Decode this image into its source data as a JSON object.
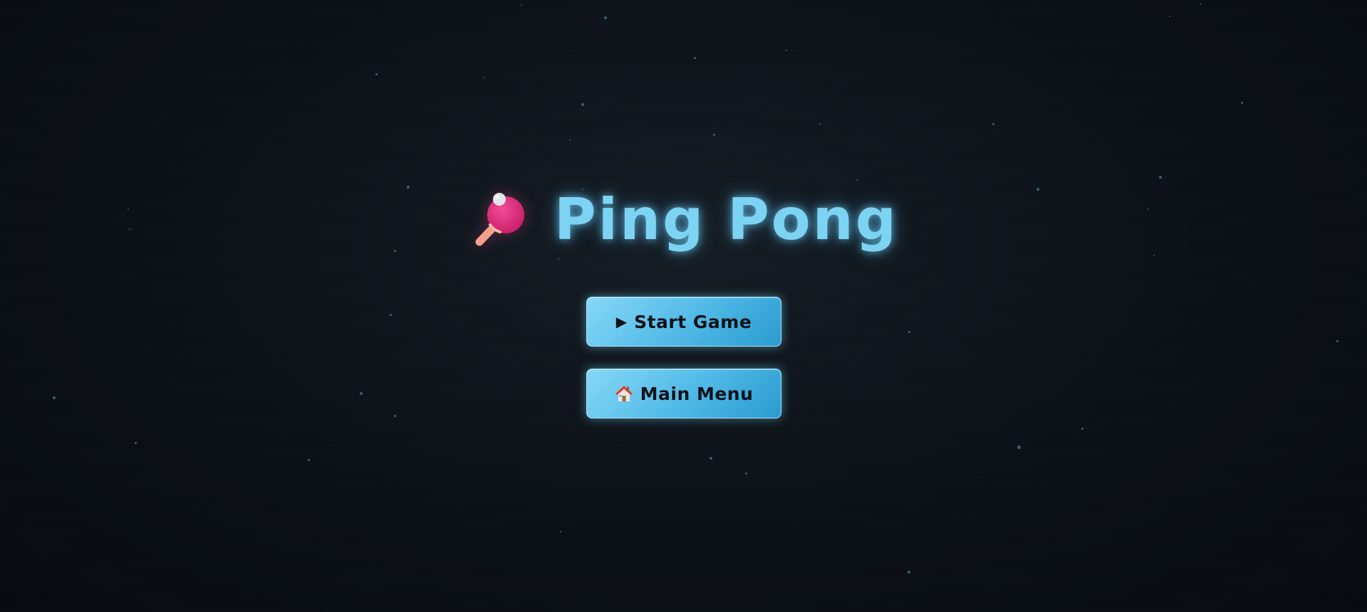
{
  "title": {
    "text": "Ping Pong",
    "icon": "ping-pong-paddle-icon",
    "color": "#7dd3f2"
  },
  "buttons": [
    {
      "id": "start",
      "icon": "play-icon",
      "icon_glyph": "▶",
      "label": "Start Game"
    },
    {
      "id": "menu",
      "icon": "house-icon",
      "label": "Main Menu"
    }
  ],
  "colors": {
    "background": "#0b1016",
    "button_gradient_start": "#86d8f7",
    "button_gradient_end": "#2a9bd0",
    "paddle": "#e8347f",
    "paddle_handle": "#f4a08c",
    "star": "#4f7a86"
  }
}
